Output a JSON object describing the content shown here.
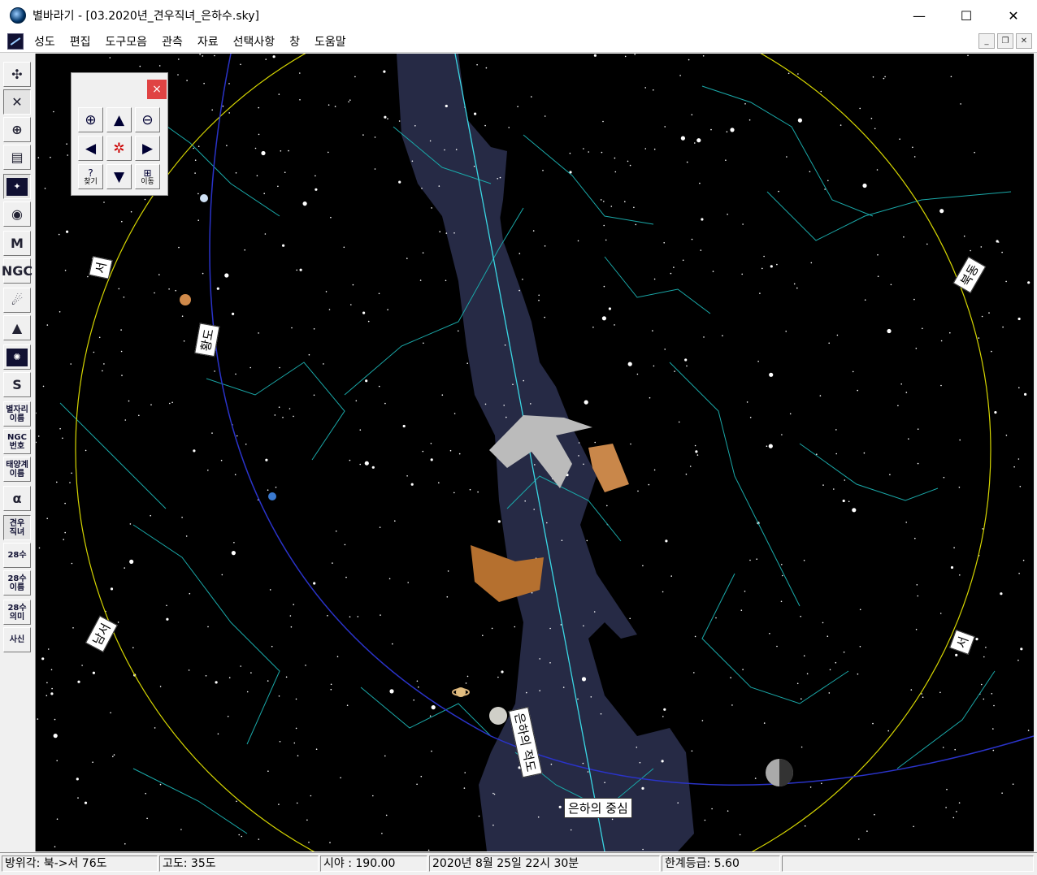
{
  "window": {
    "title": "별바라기 - [03.2020년_견우직녀_은하수.sky]",
    "minimize": "—",
    "maximize": "☐",
    "close": "✕"
  },
  "menu": {
    "items": [
      "성도",
      "편집",
      "도구모음",
      "관측",
      "자료",
      "선택사항",
      "창",
      "도움말"
    ]
  },
  "toolbar": {
    "buttons": [
      {
        "name": "view-tool",
        "glyph": "✣"
      },
      {
        "name": "constellation-line-tool",
        "glyph": "✕"
      },
      {
        "name": "grid-tool",
        "glyph": "⊕"
      },
      {
        "name": "atlas-tool",
        "glyph": "▤"
      },
      {
        "name": "starfield-tool",
        "glyph": "✦"
      },
      {
        "name": "galaxy-tool",
        "glyph": "◉"
      },
      {
        "name": "messier-tool",
        "glyph": "M"
      },
      {
        "name": "ngc-tool",
        "glyph": "NGC"
      },
      {
        "name": "comet-tool",
        "glyph": "☄"
      },
      {
        "name": "nebula-tool",
        "glyph": "▲"
      },
      {
        "name": "cluster-tool",
        "glyph": "✺"
      },
      {
        "name": "milkyway-tool",
        "glyph": "S"
      },
      {
        "name": "constellation-name-tool",
        "text": "별자리\n이름"
      },
      {
        "name": "ngc-number-tool",
        "text": "NGC\n번호"
      },
      {
        "name": "planet-name-tool",
        "text": "태양계\n이름"
      },
      {
        "name": "alpha-tool",
        "glyph": "α"
      },
      {
        "name": "gyeonwu-jiknyeo-tool",
        "text": "견우\n직녀"
      },
      {
        "name": "28su-tool",
        "text": "28수"
      },
      {
        "name": "28su-name-tool",
        "text": "28수\n이름"
      },
      {
        "name": "28su-meaning-tool",
        "text": "28수\n의미"
      },
      {
        "name": "four-gods-tool",
        "text": "사신"
      }
    ]
  },
  "navigator": {
    "close": "×",
    "find_label": "찾기",
    "move_label": "이동"
  },
  "sky_labels": {
    "ecliptic": "황도",
    "south_labels": [
      "서",
      "남",
      "동",
      "북"
    ],
    "galactic_equator": "은하의 적도",
    "galactic_center": "은하의 중심"
  },
  "status": {
    "azimuth": "방위각: 북->서  76도",
    "altitude": "고도:   35도",
    "fov": "시야 : 190.00",
    "datetime": "2020년  8월 25일 22시 30분",
    "limit_mag": "한계등급:  5.60"
  }
}
